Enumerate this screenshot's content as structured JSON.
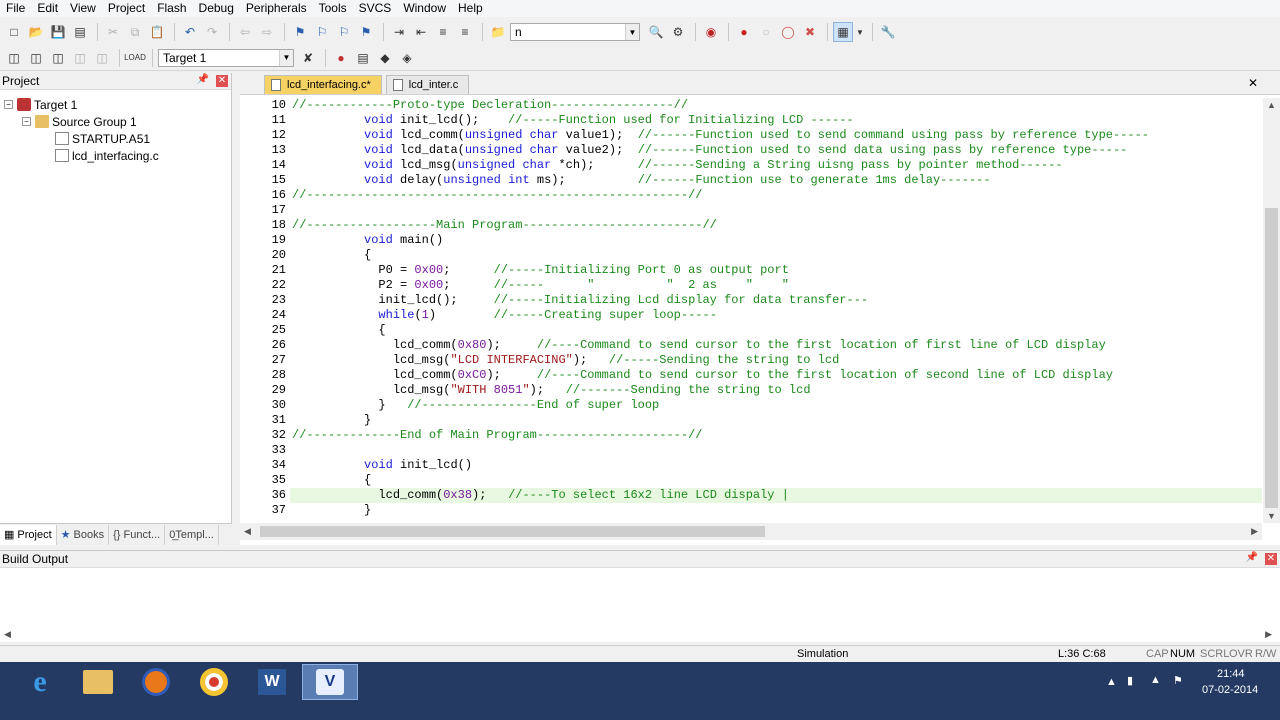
{
  "menu": [
    "File",
    "Edit",
    "View",
    "Project",
    "Flash",
    "Debug",
    "Peripherals",
    "Tools",
    "SVCS",
    "Window",
    "Help"
  ],
  "toolbar": {
    "find_value": "n",
    "target_value": "Target 1"
  },
  "project_panel": {
    "title": "Project",
    "tree": {
      "target": "Target 1",
      "group": "Source Group 1",
      "files": [
        "STARTUP.A51",
        "lcd_interfacing.c"
      ]
    },
    "tabs": [
      "Project",
      "Books",
      "{} Funct...",
      "0̲Templ..."
    ]
  },
  "editor": {
    "tabs": [
      {
        "label": "lcd_interfacing.c*",
        "active": true
      },
      {
        "label": "lcd_inter.c",
        "active": false
      }
    ],
    "current_line": 36,
    "lines": [
      {
        "n": 10,
        "text": "//------------Proto-type Decleration-----------------//"
      },
      {
        "n": 11,
        "text": "          void init_lcd();    //-----Function used for Initializing LCD ------"
      },
      {
        "n": 12,
        "text": "          void lcd_comm(unsigned char value1);  //------Function used to send command using pass by reference type-----"
      },
      {
        "n": 13,
        "text": "          void lcd_data(unsigned char value2);  //------Function used to send data using pass by reference type-----"
      },
      {
        "n": 14,
        "text": "          void lcd_msg(unsigned char *ch);      //------Sending a String uisng pass by pointer method------"
      },
      {
        "n": 15,
        "text": "          void delay(unsigned int ms);          //------Function use to generate 1ms delay-------"
      },
      {
        "n": 16,
        "text": "//-----------------------------------------------------//"
      },
      {
        "n": 17,
        "text": ""
      },
      {
        "n": 18,
        "text": "//------------------Main Program-------------------------//"
      },
      {
        "n": 19,
        "text": "          void main()"
      },
      {
        "n": 20,
        "text": "          {"
      },
      {
        "n": 21,
        "text": "            P0 = 0x00;      //-----Initializing Port 0 as output port"
      },
      {
        "n": 22,
        "text": "            P2 = 0x00;      //-----      \"          \"  2 as    \"    \""
      },
      {
        "n": 23,
        "text": "            init_lcd();     //-----Initializing Lcd display for data transfer---"
      },
      {
        "n": 24,
        "text": "            while(1)        //-----Creating super loop-----"
      },
      {
        "n": 25,
        "text": "            {"
      },
      {
        "n": 26,
        "text": "              lcd_comm(0x80);     //----Command to send cursor to the first location of first line of LCD display"
      },
      {
        "n": 27,
        "text": "              lcd_msg(\"LCD INTERFACING\");   //-----Sending the string to lcd"
      },
      {
        "n": 28,
        "text": "              lcd_comm(0xC0);     //----Command to send cursor to the first location of second line of LCD display"
      },
      {
        "n": 29,
        "text": "              lcd_msg(\"WITH 8051\");   //-------Sending the string to lcd"
      },
      {
        "n": 30,
        "text": "            }   //----------------End of super loop"
      },
      {
        "n": 31,
        "text": "          }"
      },
      {
        "n": 32,
        "text": "//-------------End of Main Program---------------------//"
      },
      {
        "n": 33,
        "text": ""
      },
      {
        "n": 34,
        "text": "          void init_lcd()"
      },
      {
        "n": 35,
        "text": "          {"
      },
      {
        "n": 36,
        "text": "            lcd_comm(0x38);   //----To select 16x2 line LCD dispaly |"
      },
      {
        "n": 37,
        "text": "          }"
      }
    ]
  },
  "build_output": {
    "title": "Build Output"
  },
  "status": {
    "mode": "Simulation",
    "position": "L:36 C:68",
    "cap": "CAP",
    "num": "NUM",
    "scrl": "SCRL",
    "ovr": "OVR",
    "rw": "R/W"
  },
  "taskbar": {
    "apps": [
      "ie",
      "explorer",
      "firefox",
      "chrome",
      "word",
      "keil"
    ],
    "time": "21:44",
    "date": "07-02-2014"
  }
}
